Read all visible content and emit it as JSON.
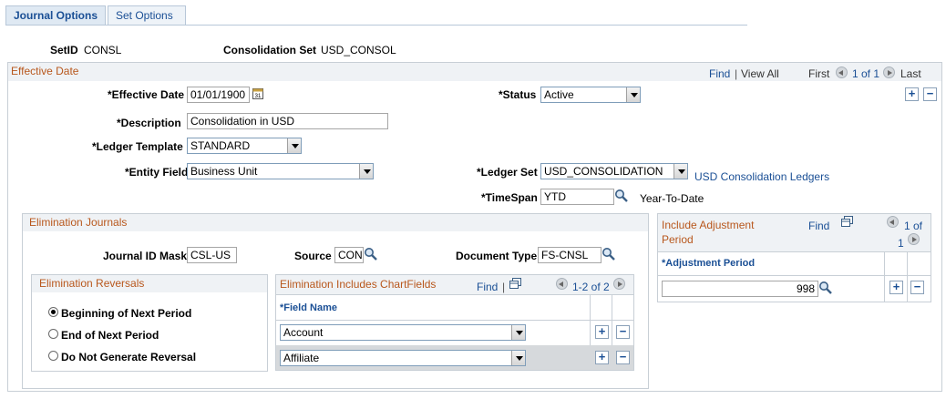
{
  "tabs": [
    {
      "label": "Journal Options",
      "active": true
    },
    {
      "label": "Set Options",
      "active": false
    }
  ],
  "header": {
    "setid_label": "SetID",
    "setid_value": "CONSL",
    "consol_set_label": "Consolidation Set",
    "consol_set_value": "USD_CONSOL"
  },
  "effective_date_section": {
    "title": "Effective Date",
    "find": "Find",
    "separator": "|",
    "view_all": "View All",
    "first": "First",
    "range": "1 of 1",
    "last": "Last",
    "effective_date_label": "*Effective Date",
    "effective_date_value": "01/01/1900",
    "status_label": "*Status",
    "status_value": "Active",
    "description_label": "*Description",
    "description_value": "Consolidation in USD",
    "ledger_template_label": "*Ledger Template",
    "ledger_template_value": "STANDARD",
    "entity_field_label": "*Entity Field",
    "entity_field_value": "Business Unit",
    "ledger_set_label": "*Ledger Set",
    "ledger_set_value": "USD_CONSOLIDATION",
    "ledger_set_link": "USD Consolidation Ledgers",
    "timespan_label": "*TimeSpan",
    "timespan_value": "YTD",
    "timespan_desc": "Year-To-Date"
  },
  "elimination_journals": {
    "title": "Elimination Journals",
    "journal_id_mask_label": "Journal ID Mask",
    "journal_id_mask_value": "CSL-US",
    "source_label": "Source",
    "source_value": "CON",
    "document_type_label": "Document Type",
    "document_type_value": "FS-CNSL"
  },
  "elimination_reversals": {
    "title": "Elimination Reversals",
    "options": [
      {
        "label": "Beginning of Next Period",
        "selected": true
      },
      {
        "label": "End of Next Period",
        "selected": false
      },
      {
        "label": "Do Not Generate Reversal",
        "selected": false
      }
    ]
  },
  "chartfields_grid": {
    "title": "Elimination Includes ChartFields",
    "find": "Find",
    "separator": "|",
    "range": "1-2 of 2",
    "column_header": "*Field Name",
    "rows": [
      {
        "value": "Account"
      },
      {
        "value": "Affiliate"
      }
    ]
  },
  "adjustment_grid": {
    "title_line1": "Include Adjustment",
    "title_line2": "Period",
    "find": "Find",
    "range_a": "1 of",
    "range_b": "1",
    "column_header": "*Adjustment Period",
    "rows": [
      {
        "value": "998"
      }
    ]
  },
  "icons": {
    "plus": "+",
    "minus": "−",
    "calendar": "calendar-icon",
    "lookup": "lookup-icon",
    "popup": "popup-grid-icon"
  },
  "colors": {
    "link": "#1a4f95",
    "section_title": "#b8571c",
    "band": "#eff2f5",
    "tab_active": "#dfe9f3"
  }
}
